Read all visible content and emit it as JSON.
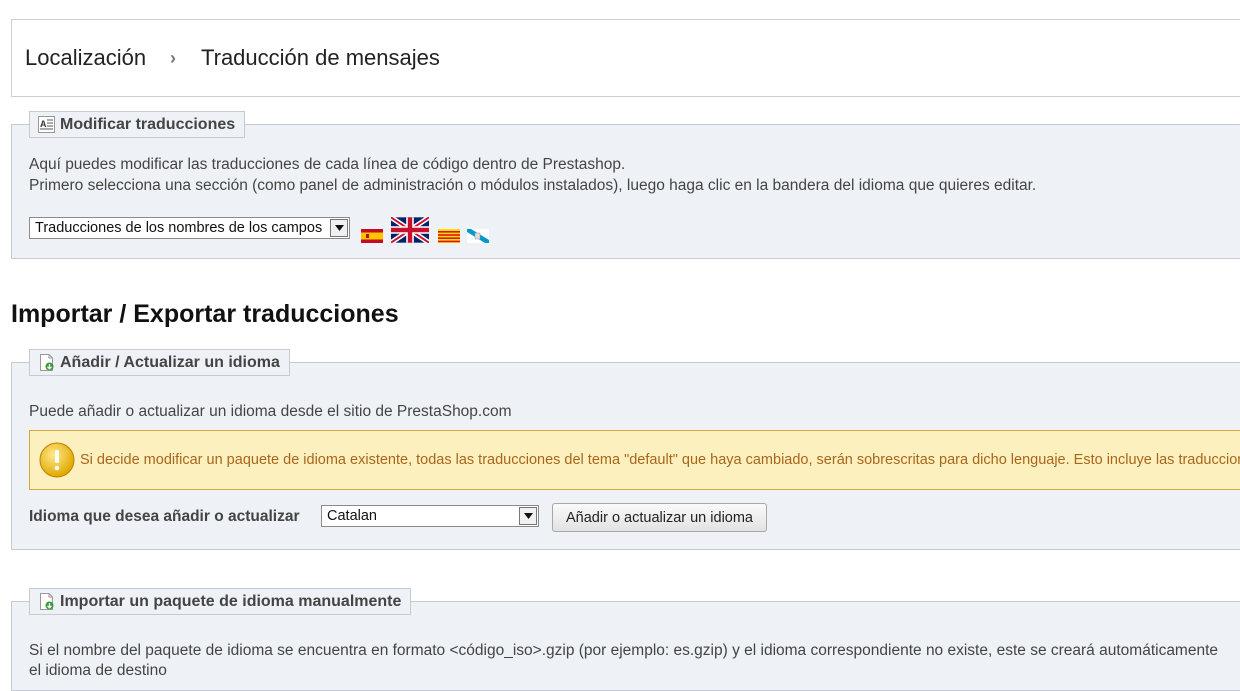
{
  "breadcrumb": {
    "parent": "Localización",
    "separator": "›",
    "current": "Traducción de mensajes"
  },
  "modify": {
    "legend": "Modificar traducciones",
    "line1": "Aquí puedes modificar las traducciones de cada línea de código dentro de Prestashop.",
    "line2": "Primero selecciona una sección (como panel de administración o módulos instalados), luego haga clic en la bandera del idioma que quieres editar.",
    "select_value": "Traducciones de los nombres de los campos",
    "flags": [
      "flag-es",
      "flag-gb",
      "flag-ca",
      "flag-gl"
    ]
  },
  "section_title": "Importar / Exportar traducciones",
  "add": {
    "legend": "Añadir / Actualizar un idioma",
    "description": "Puede añadir o actualizar un idioma desde el sitio de PrestaShop.com",
    "warning": "Si decide modificar un paquete de idioma existente, todas las traducciones del tema \"default\" que haya cambiado, serán sobrescritas para dicho lenguaje. Esto incluye las traducciones",
    "field_label": "Idioma que desea añadir o actualizar",
    "select_value": "Catalan",
    "button_label": "Añadir o actualizar un idioma"
  },
  "import": {
    "legend": "Importar un paquete de idioma manualmente",
    "line1": "Si el nombre del paquete de idioma se encuentra en formato <código_iso>.gzip (por ejemplo: es.gzip) y el idioma correspondiente no existe, este se creará automáticamente",
    "line2": "el idioma de destino"
  },
  "colors": {
    "panel_bg": "#eef1f6",
    "panel_border": "#c6cad3",
    "warning_bg": "#fdf0bf",
    "warning_border": "#d6a93a",
    "warning_text": "#a8661a"
  }
}
